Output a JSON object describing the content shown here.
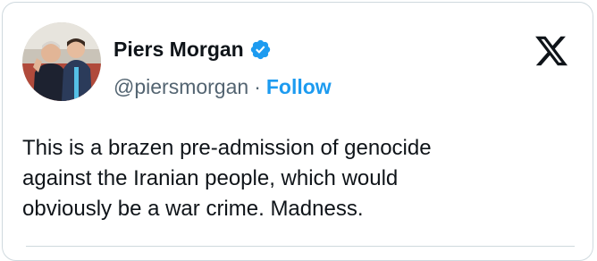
{
  "author": {
    "display_name": "Piers Morgan",
    "handle": "@piersmorgan",
    "separator": "·",
    "follow_label": "Follow"
  },
  "post": {
    "text": "This is a brazen pre-admission of genocide\nagainst the Iranian people, which would\nobviously be a war crime. Madness."
  },
  "icons": {
    "verified": "verified-badge-icon",
    "brand": "x-logo-icon"
  },
  "colors": {
    "accent": "#1d9bf0",
    "text": "#0f1419",
    "muted": "#536471",
    "border": "#cfd9de"
  }
}
